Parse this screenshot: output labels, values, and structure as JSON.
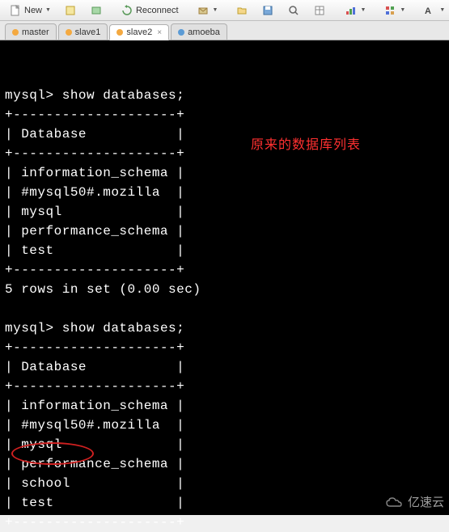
{
  "toolbar": {
    "new_label": "New",
    "reconnect_label": "Reconnect"
  },
  "tabs": [
    {
      "label": "master",
      "dot": "orange",
      "active": false,
      "closable": false
    },
    {
      "label": "slave1",
      "dot": "orange",
      "active": false,
      "closable": false
    },
    {
      "label": "slave2",
      "dot": "orange",
      "active": true,
      "closable": true
    },
    {
      "label": "amoeba",
      "dot": "blue",
      "active": false,
      "closable": false
    }
  ],
  "terminal": {
    "prompt": "mysql>",
    "command1": "show databases;",
    "sep": "+--------------------+",
    "header": "| Database           |",
    "rows1": [
      "| information_schema |",
      "| #mysql50#.mozilla  |",
      "| mysql              |",
      "| performance_schema |",
      "| test               |"
    ],
    "result1": "5 rows in set (0.00 sec)",
    "command2": "show databases;",
    "rows2": [
      "| information_schema |",
      "| #mysql50#.mozilla  |",
      "| mysql              |",
      "| performance_schema |",
      "| school             |",
      "| test               |"
    ]
  },
  "annotation": {
    "original_list": "原来的数据库列表"
  },
  "watermark": {
    "text": "亿速云"
  }
}
